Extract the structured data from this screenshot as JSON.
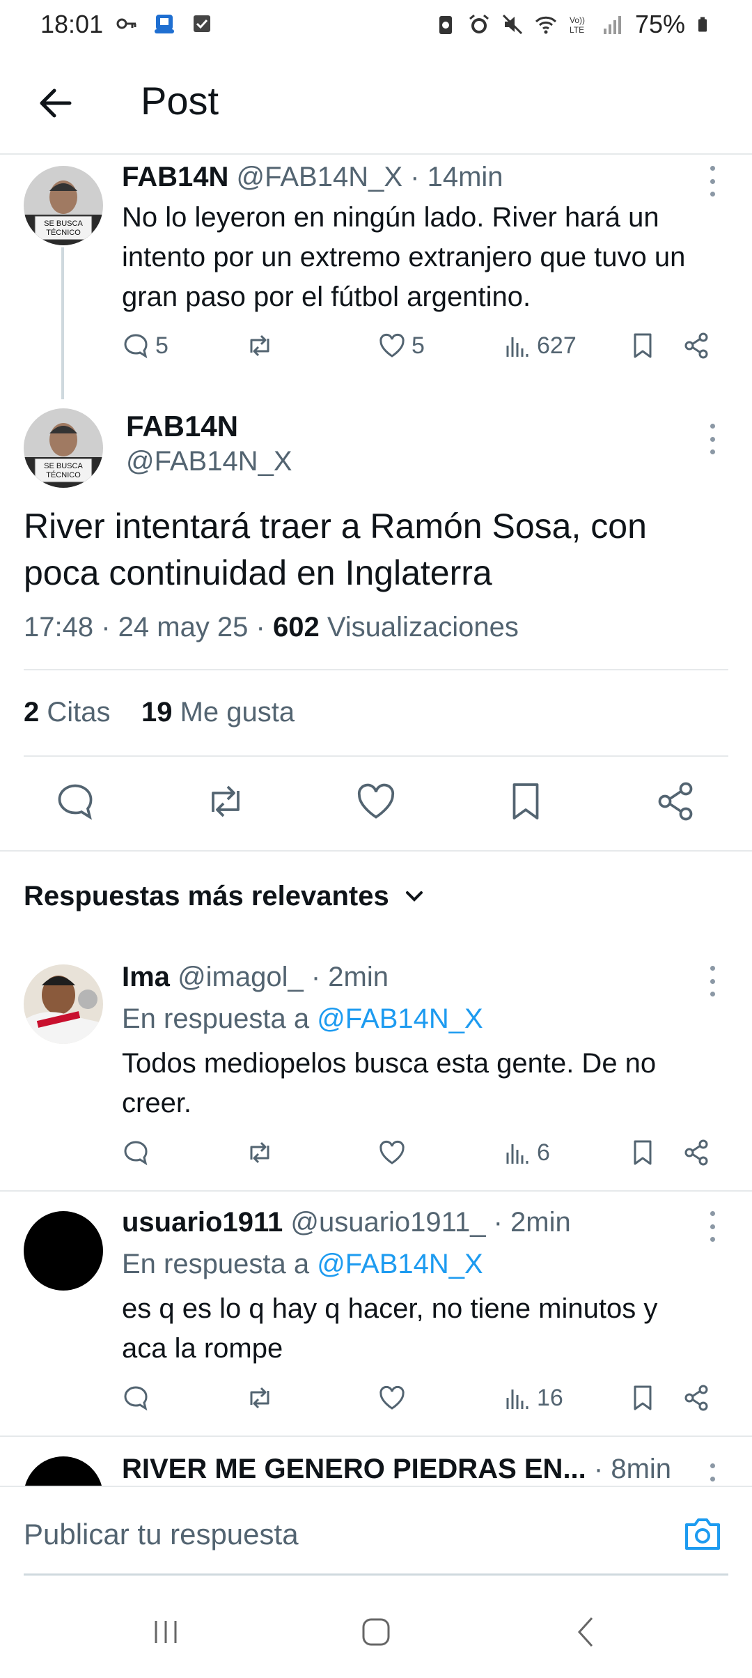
{
  "status_bar": {
    "time": "18:01",
    "battery": "75%",
    "left_icons": [
      "key-icon",
      "app-notification-icon",
      "checkbox-icon"
    ],
    "right_icons": [
      "battery-saver-icon",
      "alarm-icon",
      "mute-icon",
      "wifi-icon",
      "volte-icon",
      "signal-icon",
      "battery-icon"
    ]
  },
  "app_bar": {
    "title": "Post",
    "back_icon": "arrow-left-icon"
  },
  "parent_tweet": {
    "name": "FAB14N",
    "handle": "@FAB14N_X",
    "time": "· 14min",
    "text": "No lo leyeron en ningún lado. River hará un intento por un extremo extranjero que tuvo un gran paso por el fútbol argentino.",
    "replies": "5",
    "likes": "5",
    "views": "627",
    "avatar_caption": "SE BUSCA TÉCNICO"
  },
  "main_tweet": {
    "name": "FAB14N",
    "handle": "@FAB14N_X",
    "text": "River intentará traer a Ramón Sosa, con poca continuidad en Inglaterra",
    "timestamp": "17:48 · 24 may 25 · ",
    "views_count": "602",
    "views_label": " Visualizaciones",
    "quotes_count": "2",
    "quotes_label": " Citas",
    "likes_count": "19",
    "likes_label": " Me gusta",
    "avatar_caption": "SE BUSCA TÉCNICO"
  },
  "replies_section": {
    "sort_label": "Respuestas más relevantes"
  },
  "replies": [
    {
      "name": "Ima",
      "handle": "@imagol_",
      "time": "· 2min",
      "reply_prefix": "En respuesta a ",
      "reply_handle": "@FAB14N_X",
      "text": "Todos mediopelos busca esta gente. De no creer.",
      "views": "6"
    },
    {
      "name": "usuario1911",
      "handle": "@usuario1911_",
      "time": "· 2min",
      "reply_prefix": "En respuesta a ",
      "reply_handle": "@FAB14N_X",
      "text": "es q es lo q hay q hacer, no tiene minutos y aca la rompe",
      "views": "16"
    },
    {
      "name": "RIVER ME GENERO PIEDRAS EN...",
      "time": "· 8min"
    }
  ],
  "composer": {
    "placeholder": "Publicar tu respuesta",
    "icon": "camera-icon"
  },
  "colors": {
    "accent": "#1d9bf0",
    "text": "#0f1419",
    "secondary": "#536471",
    "divider": "#e6e9eb"
  }
}
